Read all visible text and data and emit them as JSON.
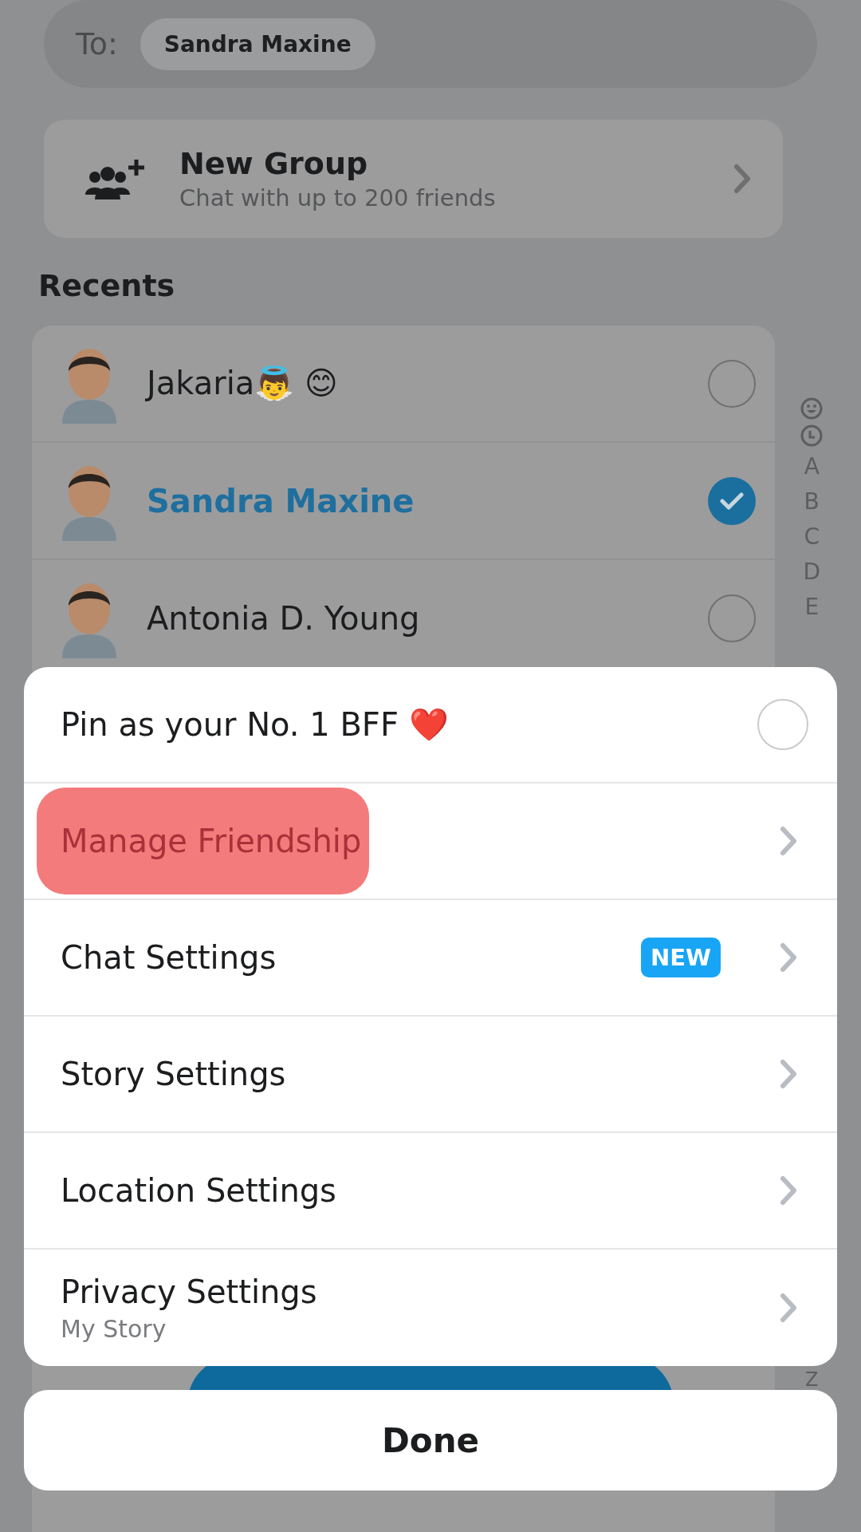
{
  "recipient_bar": {
    "label": "To:",
    "chips": [
      "Sandra Maxine"
    ]
  },
  "new_group": {
    "title": "New Group",
    "subtitle": "Chat with up to 200 friends"
  },
  "section_title": "Recents",
  "contacts": [
    {
      "name": "Jakaria👼 😊",
      "selected": false
    },
    {
      "name": "Sandra Maxine",
      "selected": true
    },
    {
      "name": "Antonia D. Young",
      "selected": false
    }
  ],
  "index_letters": [
    "A",
    "B",
    "C",
    "D",
    "E"
  ],
  "index_end": "Z",
  "sheet": {
    "items": [
      {
        "kind": "toggle",
        "label": "Pin as your No. 1 BFF ❤️",
        "checked": false
      },
      {
        "kind": "link",
        "label": "Manage Friendship",
        "highlighted": true
      },
      {
        "kind": "link",
        "label": "Chat Settings",
        "badge": "NEW",
        "highlighted": false
      },
      {
        "kind": "link",
        "label": "Story Settings",
        "highlighted": false
      },
      {
        "kind": "link",
        "label": "Location Settings",
        "highlighted": false
      },
      {
        "kind": "link",
        "label": "Privacy Settings",
        "sublabel": "My Story",
        "highlighted": false
      }
    ]
  },
  "done": "Done"
}
